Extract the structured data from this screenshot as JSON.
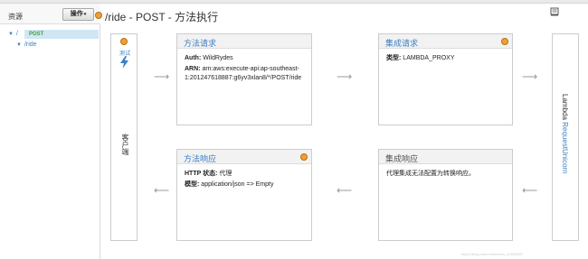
{
  "sidebar": {
    "resources_label": "资源",
    "ops_button_label": "操作",
    "tree": [
      {
        "label": "/"
      },
      {
        "label": "/ride"
      },
      {
        "label": "POST"
      }
    ]
  },
  "header": {
    "title": "/ride - POST - 方法执行"
  },
  "client": {
    "test_label": "测试",
    "label": "客户端"
  },
  "method_request": {
    "title": "方法请求",
    "auth_key": "Auth:",
    "auth_value": "WildRydes",
    "arn_key": "ARN:",
    "arn_value_line1": "arn:aws:execute-api:ap-southeast-",
    "arn_value_line2": "1:201247618887:g6yv3xlan8/*/POST/ride"
  },
  "integration_request": {
    "title": "集成请求",
    "type_key": "类型:",
    "type_value": "LAMBDA_PROXY"
  },
  "method_response": {
    "title": "方法响应",
    "status_key": "HTTP 状态:",
    "status_value": "代理",
    "model_key": "模型:",
    "model_value": "application/json => Empty"
  },
  "integration_response": {
    "title": "集成响应",
    "text": "代理集成无法配置为转换响应。"
  },
  "lambda": {
    "label": "Lambda",
    "function_name": "RequestUnicorn"
  },
  "watermark": "https://blog.csdn.net/weixin_43318387"
}
